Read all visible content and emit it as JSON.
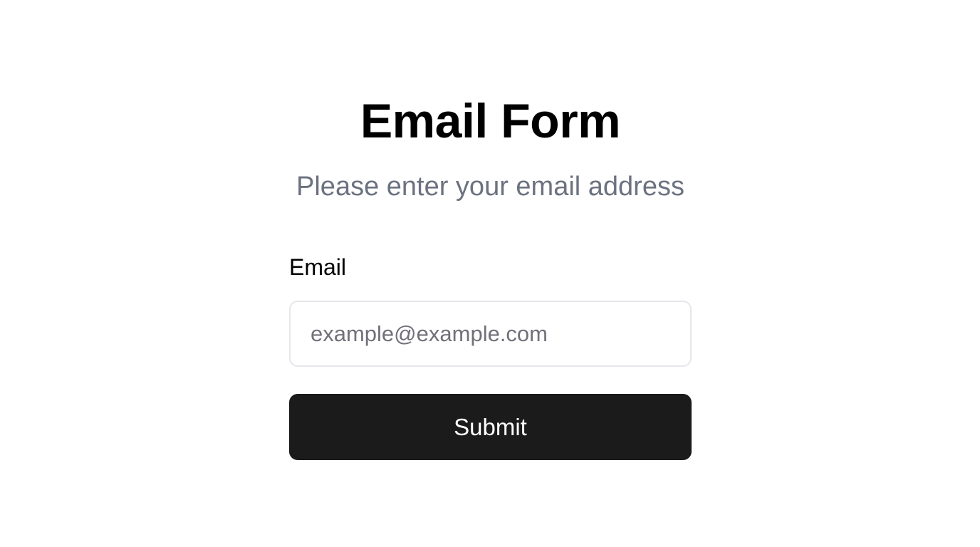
{
  "form": {
    "title": "Email Form",
    "subtitle": "Please enter your email address",
    "email_label": "Email",
    "email_placeholder": "example@example.com",
    "email_value": "",
    "submit_label": "Submit"
  },
  "colors": {
    "background": "#ffffff",
    "title_text": "#000000",
    "subtitle_text": "#6b7280",
    "input_border": "#e5e7eb",
    "placeholder_text": "#71717a",
    "button_background": "#1b1b1c",
    "button_text": "#ffffff"
  }
}
